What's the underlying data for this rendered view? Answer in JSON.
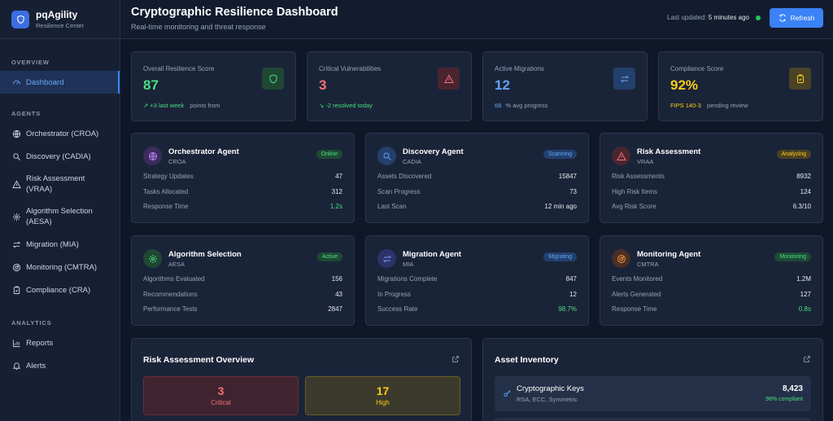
{
  "brand": {
    "title": "pqAgility",
    "subtitle": "Resilience Center"
  },
  "sidebar": {
    "sections": [
      {
        "label": "OVERVIEW"
      },
      {
        "label": "AGENTS"
      },
      {
        "label": "ANALYTICS"
      }
    ],
    "items": [
      {
        "label": "Dashboard",
        "icon": "gauge-icon"
      },
      {
        "label": "Orchestrator (CROA)",
        "icon": "network-icon"
      },
      {
        "label": "Discovery (CADIA)",
        "icon": "search-icon"
      },
      {
        "label": "Risk Assessment (VRAA)",
        "icon": "warning-icon"
      },
      {
        "label": "Algorithm Selection (AESA)",
        "icon": "gear-icon"
      },
      {
        "label": "Migration (MIA)",
        "icon": "swap-icon"
      },
      {
        "label": "Monitoring (CMTRA)",
        "icon": "radar-icon"
      },
      {
        "label": "Compliance (CRA)",
        "icon": "clipboard-icon"
      },
      {
        "label": "Reports",
        "icon": "bar-chart-icon"
      },
      {
        "label": "Alerts",
        "icon": "bell-icon"
      }
    ]
  },
  "header": {
    "title": "Cryptographic Resilience Dashboard",
    "subtitle": "Real-time monitoring and threat response",
    "updated_prefix": "Last updated:",
    "updated_value": "5 minutes ago",
    "refresh_label": "Refresh"
  },
  "stats": [
    {
      "label": "Overall Resilience Score",
      "value": "87",
      "foot_a": "+3 last week",
      "foot_b": "points from",
      "color": "#4ade80"
    },
    {
      "label": "Critical Vulnerabilities",
      "value": "3",
      "foot_a": "-2 resolved today",
      "foot_b": "",
      "color": "#f87171"
    },
    {
      "label": "Active Migrations",
      "value": "12",
      "foot_a": "68",
      "foot_b": "% avg progress",
      "color": "#60a5fa"
    },
    {
      "label": "Compliance Score",
      "value": "92%",
      "foot_a": "FIPS 140-3",
      "foot_b": "pending review",
      "color": "#facc15"
    }
  ],
  "agents": [
    {
      "name": "Orchestrator Agent",
      "code": "CROA",
      "status": "Online",
      "metrics": [
        {
          "label": "Strategy Updates",
          "value": "47"
        },
        {
          "label": "Tasks Allocated",
          "value": "312"
        },
        {
          "label": "Response Time",
          "value": "1.2s"
        }
      ]
    },
    {
      "name": "Discovery Agent",
      "code": "CADIA",
      "status": "Scanning",
      "metrics": [
        {
          "label": "Assets Discovered",
          "value": "15847"
        },
        {
          "label": "Scan Progress",
          "value": "73"
        },
        {
          "label": "Last Scan",
          "value": "12 min ago"
        }
      ]
    },
    {
      "name": "Risk Assessment",
      "code": "VRAA",
      "status": "Analyzing",
      "metrics": [
        {
          "label": "Risk Assessments",
          "value": "8932"
        },
        {
          "label": "High Risk Items",
          "value": "124"
        },
        {
          "label": "Avg Risk Score",
          "value": "6.3/10"
        }
      ]
    },
    {
      "name": "Algorithm Selection",
      "code": "AESA",
      "status": "Active",
      "metrics": [
        {
          "label": "Algorithms Evaluated",
          "value": "156"
        },
        {
          "label": "Recommendations",
          "value": "43"
        },
        {
          "label": "Performance Tests",
          "value": "2847"
        }
      ]
    },
    {
      "name": "Migration Agent",
      "code": "MIA",
      "status": "Migrating",
      "metrics": [
        {
          "label": "Migrations Complete",
          "value": "847"
        },
        {
          "label": "In Progress",
          "value": "12"
        },
        {
          "label": "Success Rate",
          "value": "98.7%"
        }
      ]
    },
    {
      "name": "Monitoring Agent",
      "code": "CMTRA",
      "status": "Monitoring",
      "metrics": [
        {
          "label": "Events Monitored",
          "value": "1.2M"
        },
        {
          "label": "Alerts Generated",
          "value": "127"
        },
        {
          "label": "Response Time",
          "value": "0.8s"
        }
      ]
    }
  ],
  "risk_overview": {
    "title": "Risk Assessment Overview",
    "critical": {
      "value": "3",
      "label": "Critical"
    },
    "high": {
      "value": "17",
      "label": "High"
    }
  },
  "asset_inventory": {
    "title": "Asset Inventory",
    "items": [
      {
        "name": "Cryptographic Keys",
        "sub": "RSA, ECC, Symmetric",
        "count": "8,423",
        "compliance": "98% compliant"
      }
    ]
  },
  "colors": {
    "accent": "#3b82f6",
    "green": "#4ade80",
    "red": "#f87171",
    "blue": "#60a5fa",
    "yellow": "#facc15",
    "background": "#0f1729",
    "card": "#1a2438"
  }
}
